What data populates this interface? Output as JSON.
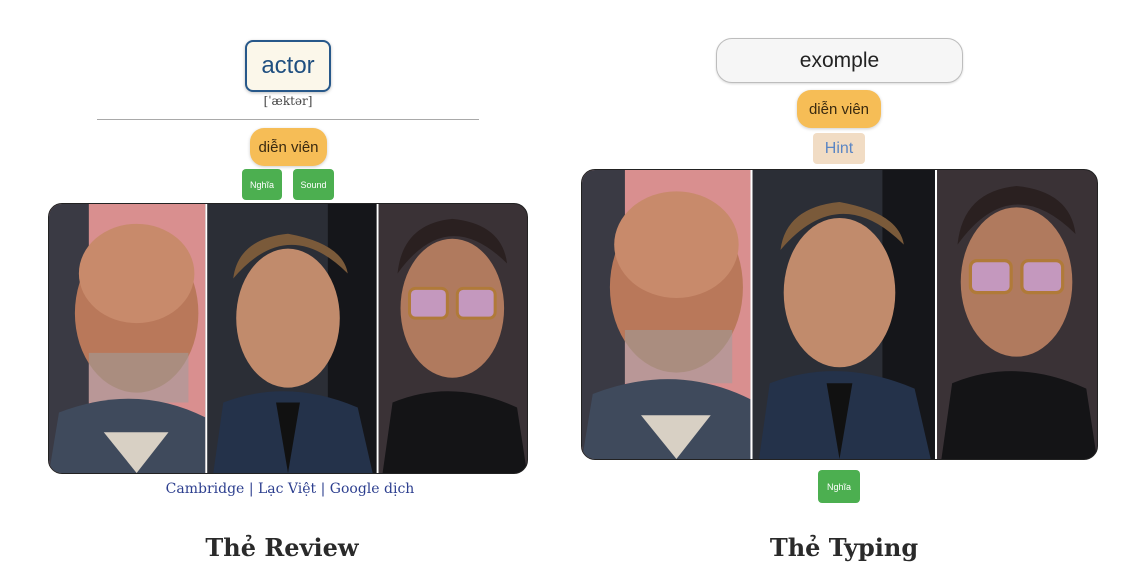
{
  "review_card": {
    "word": "actor",
    "ipa": "[ˈæktər]",
    "meaning": "diễn viên",
    "meaning_button": "Nghĩa",
    "sound_button": "Sound",
    "links": [
      "Cambridge",
      "Lạc Việt",
      "Google dịch"
    ],
    "link_separator": "|",
    "caption": "Thẻ Review"
  },
  "typing_card": {
    "input_value": "exomple",
    "meaning": "diễn viên",
    "hint_button": "Hint",
    "meaning_button": "Nghĩa",
    "caption": "Thẻ Typing"
  },
  "colors": {
    "word_border": "#27588a",
    "meaning_pill": "#f6bd56",
    "green_button": "#4caf50",
    "hint_bg": "#f1dcc4",
    "link": "#2d3f8f"
  }
}
